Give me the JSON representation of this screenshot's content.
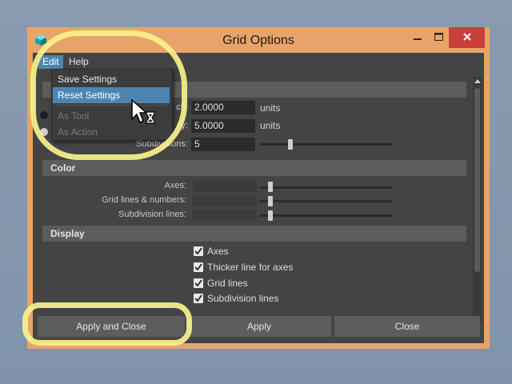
{
  "window": {
    "title": "Grid Options",
    "accent_color": "#e8a468",
    "controls": {
      "minimize_icon": "minimize-icon",
      "maximize_icon": "maximize-icon",
      "close_icon": "close-icon"
    }
  },
  "menubar": {
    "items": [
      {
        "label": "Edit"
      },
      {
        "label": "Help"
      }
    ]
  },
  "edit_menu": {
    "items": [
      {
        "label": "Save Settings",
        "state": "normal"
      },
      {
        "label": "Reset Settings",
        "state": "hover"
      },
      {
        "label": "As Tool",
        "state": "disabled"
      },
      {
        "label": "As Action",
        "state": "disabled"
      }
    ]
  },
  "size": {
    "length_label_partial": "ch:",
    "length_value": "2.0000",
    "length_unit": "units",
    "spacing_label_partial": "ry:",
    "spacing_value": "5.0000",
    "spacing_unit": "units",
    "subdivisions_label": "Subdivisions:",
    "subdivisions_value": "5"
  },
  "color": {
    "heading": "Color",
    "axes_label": "Axes:",
    "grid_lines_label": "Grid lines & numbers:",
    "subdivision_lines_label": "Subdivision lines:"
  },
  "display": {
    "heading": "Display",
    "checkboxes": [
      {
        "label": "Axes",
        "checked": true
      },
      {
        "label": "Thicker line for axes",
        "checked": true
      },
      {
        "label": "Grid lines",
        "checked": true
      },
      {
        "label": "Subdivision lines",
        "checked": true
      }
    ]
  },
  "buttons": {
    "apply_close": "Apply and Close",
    "apply": "Apply",
    "close": "Close"
  },
  "annotation_color": "#f7f28c"
}
